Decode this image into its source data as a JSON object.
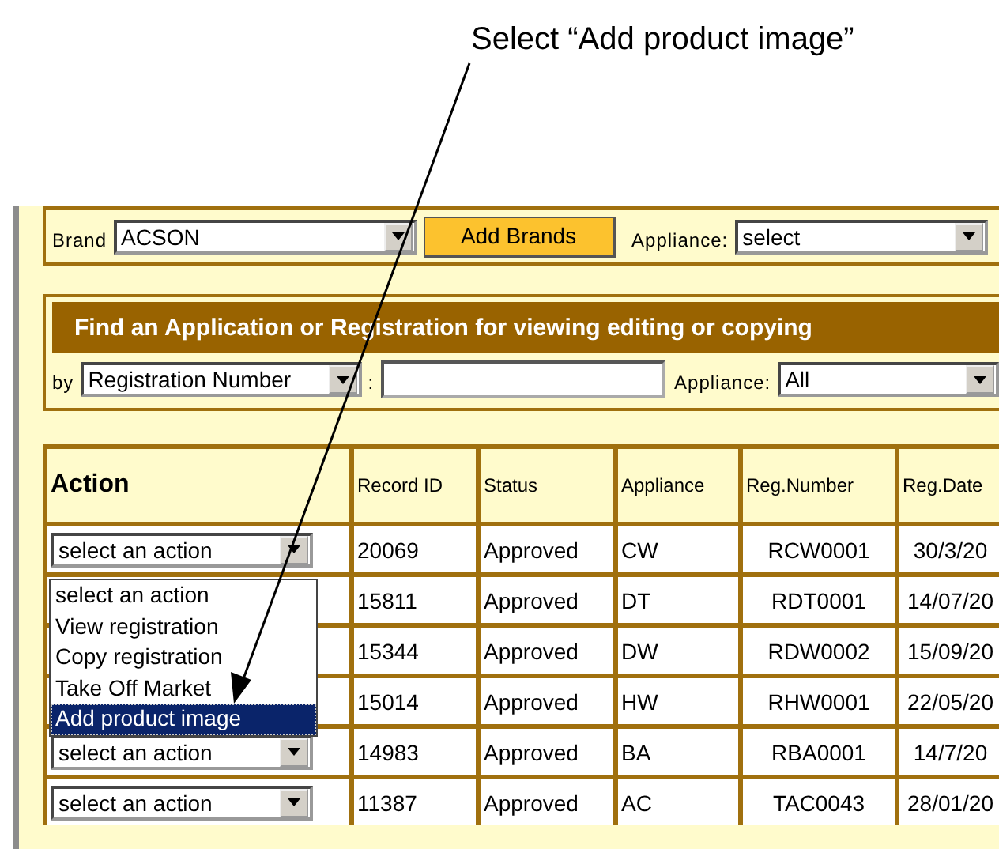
{
  "callout": {
    "text": "Select “Add product image”"
  },
  "brand_bar": {
    "brand_label": "Brand",
    "brand_value": "ACSON",
    "add_button": "Add Brands",
    "appliance_label": "Appliance:",
    "appliance_value": "select"
  },
  "find_panel": {
    "title": "Find an Application or Registration for viewing editing or copying",
    "by_label": "by",
    "by_value": "Registration Number",
    "separator": ":",
    "appliance_label": "Appliance:",
    "appliance_value": "All"
  },
  "table": {
    "columns": [
      "Action",
      "Record ID",
      "Status",
      "Appliance",
      "Reg.Number",
      "Reg.Date"
    ],
    "rows": [
      {
        "action": "select an action",
        "record_id": "20069",
        "status": "Approved",
        "appliance": "CW",
        "reg_number": "RCW0001",
        "reg_date": "30/3/20"
      },
      {
        "record_id": "15811",
        "status": "Approved",
        "appliance": "DT",
        "reg_number": "RDT0001",
        "reg_date": "14/07/20"
      },
      {
        "record_id": "15344",
        "status": "Approved",
        "appliance": "DW",
        "reg_number": "RDW0002",
        "reg_date": "15/09/20"
      },
      {
        "record_id": "15014",
        "status": "Approved",
        "appliance": "HW",
        "reg_number": "RHW0001",
        "reg_date": "22/05/20"
      },
      {
        "action": "select an action",
        "record_id": "14983",
        "status": "Approved",
        "appliance": "BA",
        "reg_number": "RBA0001",
        "reg_date": "14/7/20"
      },
      {
        "action": "select an action",
        "record_id": "11387",
        "status": "Approved",
        "appliance": "AC",
        "reg_number": "TAC0043",
        "reg_date": "28/01/20"
      }
    ]
  },
  "action_menu": {
    "options": [
      {
        "label": "select an action",
        "selected": false
      },
      {
        "label": "View registration",
        "selected": false
      },
      {
        "label": "Copy registration",
        "selected": false
      },
      {
        "label": "Take Off Market",
        "selected": false
      },
      {
        "label": "Add product image",
        "selected": true
      }
    ]
  }
}
